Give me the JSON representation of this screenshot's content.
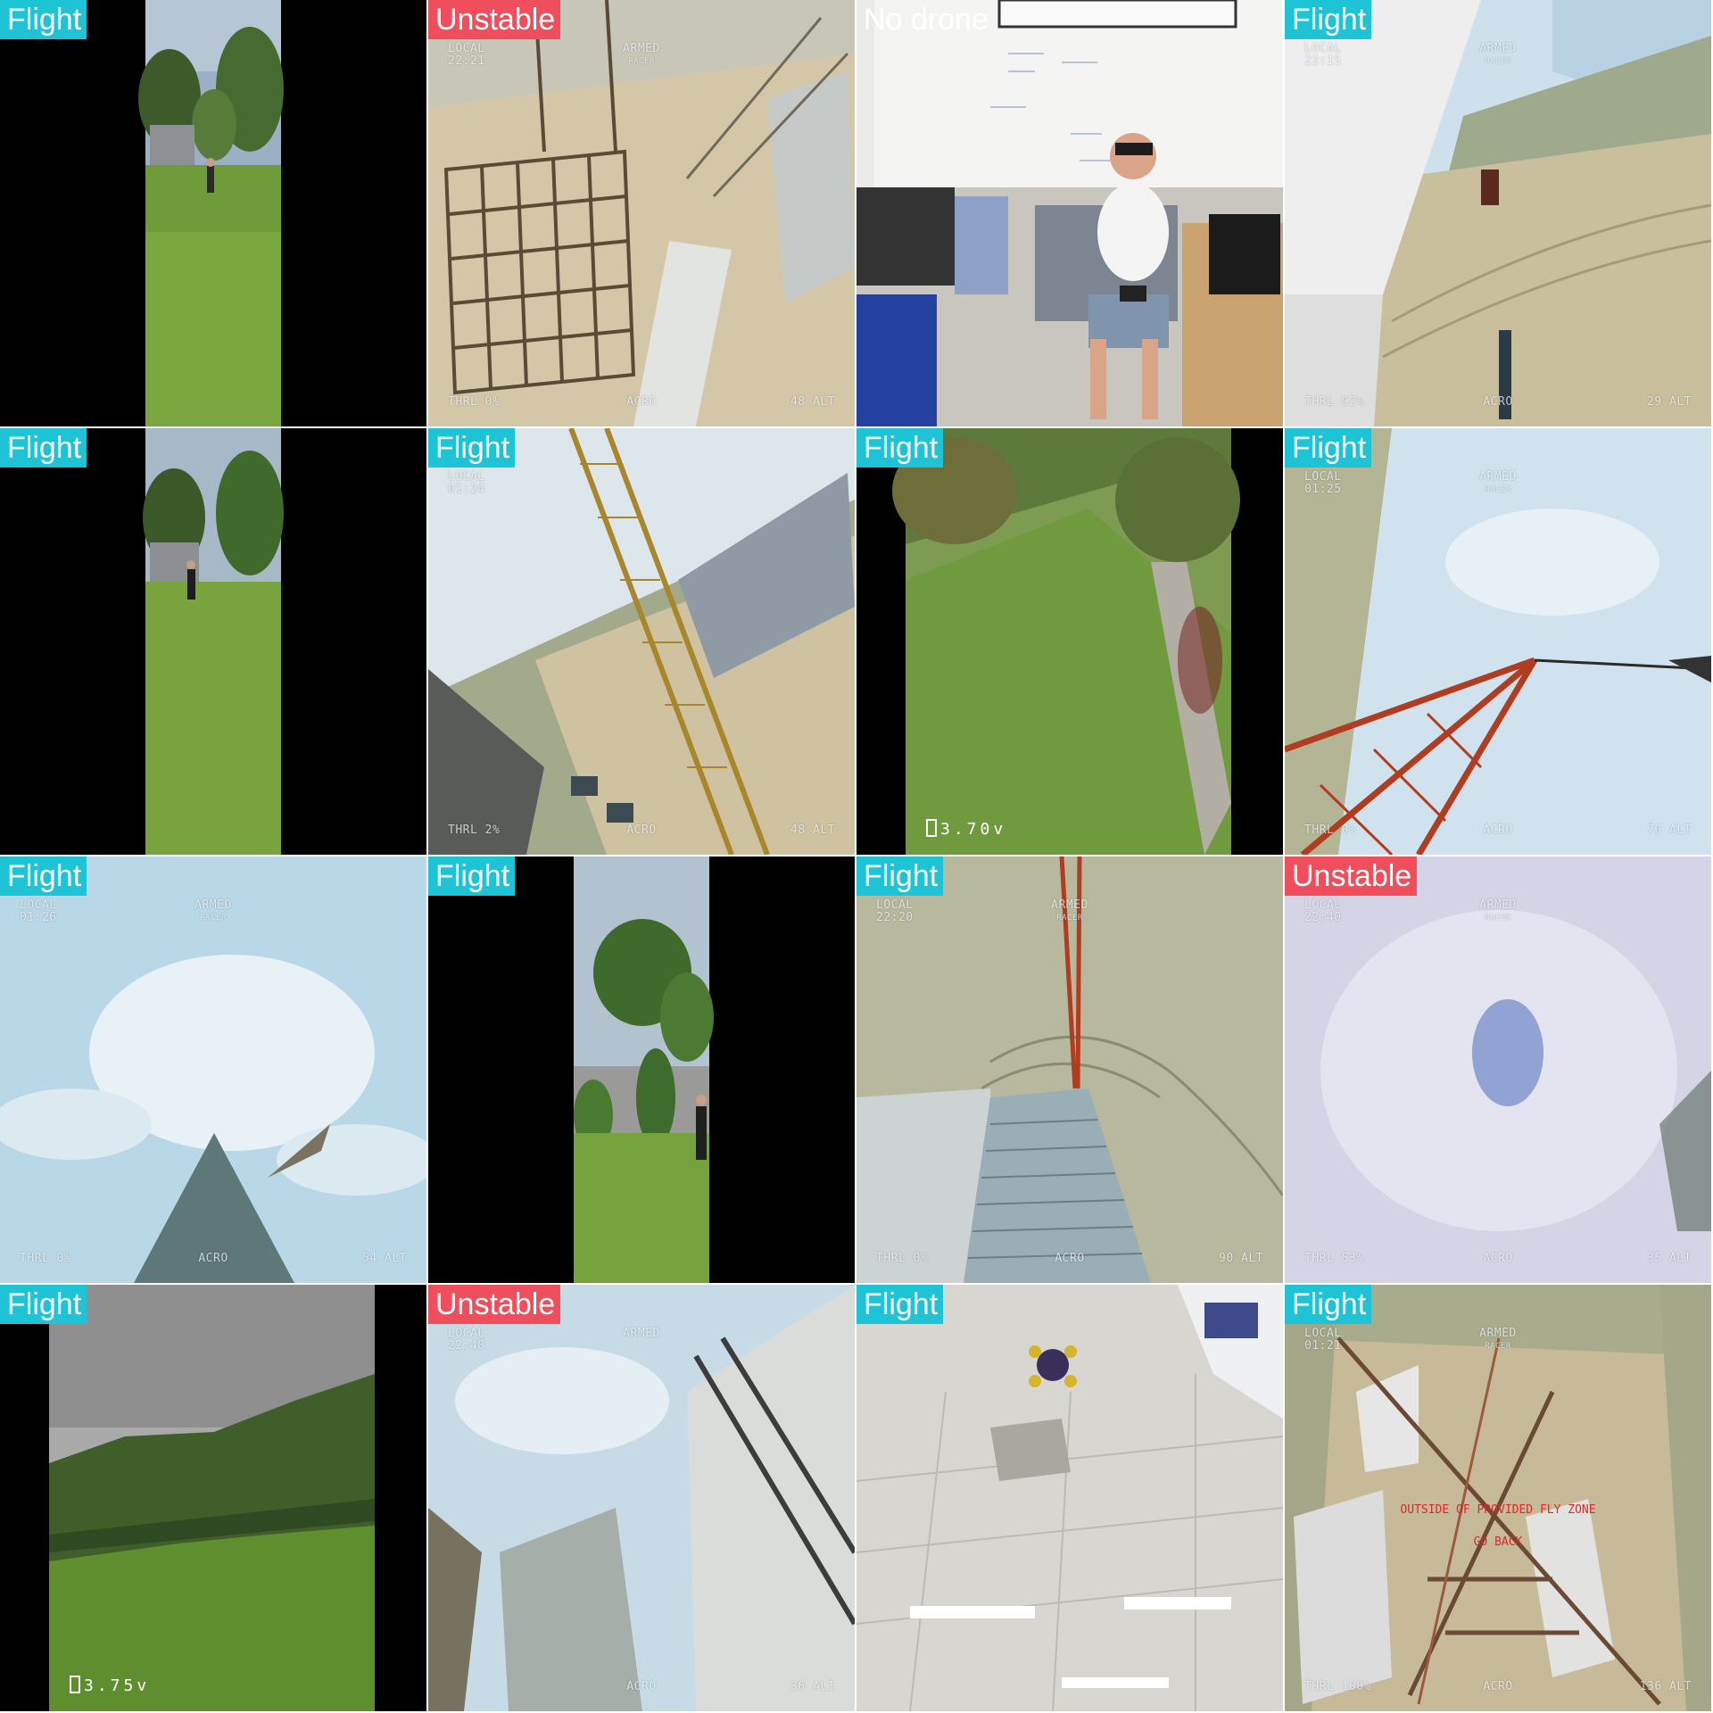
{
  "colors": {
    "flight": "#1fc3d6",
    "unstable": "#ef4f5c"
  },
  "tiles": [
    {
      "label": "Flight"
    },
    {
      "label": "Unstable",
      "osd": {
        "tl1": "LOCAL",
        "tl2": "22:21",
        "tm1": "ARMED",
        "tm2": "RACER",
        "bl": "THRL 0%",
        "bm": "ACRO",
        "br": "48 ALT"
      }
    },
    {
      "label": "No drone"
    },
    {
      "label": "Flight",
      "osd": {
        "tl1": "LOCAL",
        "tl2": "22:15",
        "tm1": "ARMED",
        "tm2": "RACER",
        "bl": "THRL 92%",
        "bm": "ACRO",
        "br": "29 ALT"
      }
    },
    {
      "label": "Flight"
    },
    {
      "label": "Flight",
      "osd": {
        "tl1": "LOCAL",
        "tl2": "01:24",
        "bl": "THRL 2%",
        "bm": "ACRO",
        "br": "48 ALT"
      }
    },
    {
      "label": "Flight",
      "voltage": "3.70v"
    },
    {
      "label": "Flight",
      "osd": {
        "tl1": "LOCAL",
        "tl2": "01:25",
        "tm1": "ARMED",
        "tm2": "RACER",
        "bl": "THRL 0%",
        "bm": "ACRO",
        "br": "70 ALT"
      }
    },
    {
      "label": "Flight",
      "osd": {
        "tl1": "LOCAL",
        "tl2": "01:26",
        "tm1": "ARMED",
        "tm2": "RACER",
        "bl": "THRL 0%",
        "bm": "ACRO",
        "br": "54 ALT"
      }
    },
    {
      "label": "Flight"
    },
    {
      "label": "Flight",
      "osd": {
        "tl1": "LOCAL",
        "tl2": "22:20",
        "tm1": "ARMED",
        "tm2": "RACER",
        "bl": "THRL 0%",
        "bm": "ACRO",
        "br": "90 ALT"
      }
    },
    {
      "label": "Unstable",
      "osd": {
        "tl1": "LOCAL",
        "tl2": "22:40",
        "tm1": "ARMED",
        "tm2": "RACER",
        "bl": "THRL 53%",
        "bm": "ACRO",
        "br": "35 ALT"
      }
    },
    {
      "label": "Flight",
      "voltage": "3.75v"
    },
    {
      "label": "Unstable",
      "osd": {
        "tl1": "LOCAL",
        "tl2": "22:40",
        "tm1": "ARMED",
        "bm": "ACRO",
        "br": "36 ALT"
      }
    },
    {
      "label": "Flight"
    },
    {
      "label": "Flight",
      "osd": {
        "tl1": "LOCAL",
        "tl2": "01:21",
        "tm1": "ARMED",
        "tm2": "RACER",
        "bl": "THRL 100%",
        "bm": "ACRO",
        "br": "136 ALT"
      },
      "warning": {
        "line1": "OUTSIDE OF PROVIDED FLY ZONE",
        "line2": "GO BACK"
      }
    }
  ]
}
